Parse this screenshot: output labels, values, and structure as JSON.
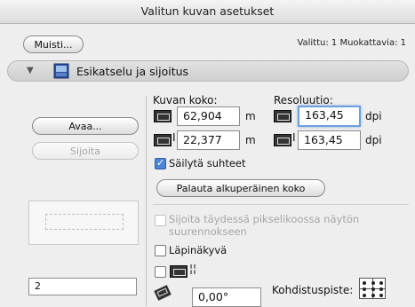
{
  "window": {
    "title": "Valitun kuvan asetukset"
  },
  "top": {
    "note_button": "Muisti...",
    "status": "Valittu: 1 Muokattavia: 1"
  },
  "section": {
    "title": "Esikatselu ja sijoitus"
  },
  "left": {
    "open_button": "Avaa...",
    "place_button": "Sijoita",
    "page_field_value": "2"
  },
  "size": {
    "heading": "Kuvan koko:",
    "width_value": "62,904",
    "height_value": "22,377",
    "unit": "m"
  },
  "resolution": {
    "heading": "Resoluutio:",
    "h_value": "163,45",
    "v_value": "163,45",
    "unit": "dpi"
  },
  "options": {
    "keep_proportions": "Säilytä suhteet",
    "restore_button": "Palauta alkuperäinen koko",
    "place_full_pixel": "Sijoita täydessä pikselikoossa näytön suurennokseen",
    "transparent": "Läpinäkyvä"
  },
  "rotation": {
    "value": "0,00°"
  },
  "anchor": {
    "label": "Kohdistuspiste:"
  },
  "colors": {
    "focus_blue": "#6f9fd8",
    "check_blue": "#4c86d6"
  }
}
